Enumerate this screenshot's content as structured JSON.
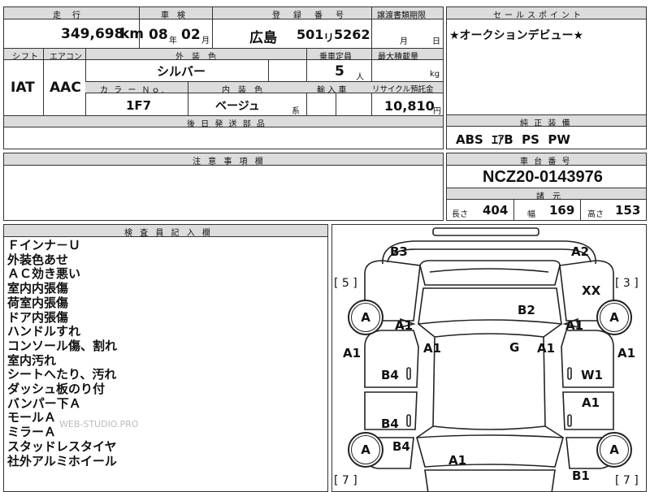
{
  "top_table": {
    "headers": {
      "mileage": "走　行",
      "inspection": "車　検",
      "registration": "登　録　番　号",
      "transfer_deadline": "譲渡書類期限",
      "sales_point": "セールスポイント"
    },
    "mileage_value": "349,698",
    "mileage_unit": "km",
    "inspection_year": "08",
    "inspection_year_unit": "年",
    "inspection_month": "02",
    "inspection_month_unit": "月",
    "registration_region": "広島",
    "registration_class": "501",
    "registration_kana": "リ",
    "registration_number": "5262",
    "transfer_month_unit": "月",
    "transfer_day_unit": "日"
  },
  "sales_point_text": "★オークションデビュー★",
  "specs": {
    "shift_header": "シフト",
    "ac_header": "エアコン",
    "exterior_color_header": "外　装　色",
    "capacity_header": "乗車定員",
    "max_load_header": "最大積載量",
    "shift_value": "IAT",
    "ac_value": "AAC",
    "exterior_color_value": "シルバー",
    "capacity_value": "5",
    "capacity_unit": "人",
    "max_load_unit": "kg",
    "color_no_header": "カ ラ ー Ｎｏ.",
    "interior_color_header": "内　装　色",
    "import_header": "輸 入 車",
    "recycle_header": "リサイクル預託金",
    "color_no_value": "1F7",
    "interior_color_value": "ベージュ",
    "interior_color_suffix": "系",
    "recycle_value": "10,810",
    "recycle_unit": "円",
    "later_parts_header": "後 日 発 送 部 品"
  },
  "genuine_equipment": {
    "header": "純 正 装 備",
    "value": "ABS  ｴｱB  PS  PW"
  },
  "caution": {
    "header": "注 意 事 項 欄"
  },
  "chassis": {
    "header": "車 台 番 号",
    "value": "NCZ20-0143976",
    "dimensions_header": "諸　元",
    "length_label": "長さ",
    "length_value": "404",
    "width_label": "幅",
    "width_value": "169",
    "height_label": "高さ",
    "height_value": "153"
  },
  "inspector": {
    "header": "検 査 員 記 入 欄",
    "notes": [
      "Ｆインナ－Ｕ",
      "外装色あせ",
      "ＡＣ効き悪い",
      "室内内張傷",
      "荷室内張傷",
      "ドア内張傷",
      "ハンドルすれ",
      "コンソール傷、割れ",
      "室内汚れ",
      "シートへたり、汚れ",
      "ダッシュ板のり付",
      "バンパー下Ａ",
      "モールＡ",
      "ミラーＡ",
      "スタッドレスタイヤ",
      "社外アルミホイール"
    ],
    "watermark": "WEB-STUDIO.PRO"
  },
  "diagram": {
    "bracket_left_top": "[ 5 ]",
    "bracket_right_top": "[ 3 ]",
    "bracket_left_bottom": "[ 7 ]",
    "bracket_right_bottom": "[ 7 ]",
    "tire_label": "A",
    "marks": {
      "B3": "B3",
      "A2": "A2",
      "XX": "XX",
      "B2": "B2",
      "A1_front_left": "A1",
      "A1_front_right": "A1",
      "A1_left_edge": "A1",
      "A1_right_edge": "A1",
      "A1_pillar_left": "A1",
      "A1_pillar_right": "A1",
      "G": "G",
      "B4_left_upper": "B4",
      "W1": "W1",
      "A1_right_door": "A1",
      "B4_left_lower": "B4",
      "B4_left_rear": "B4",
      "A1_rear": "A1",
      "B1": "B1"
    }
  }
}
